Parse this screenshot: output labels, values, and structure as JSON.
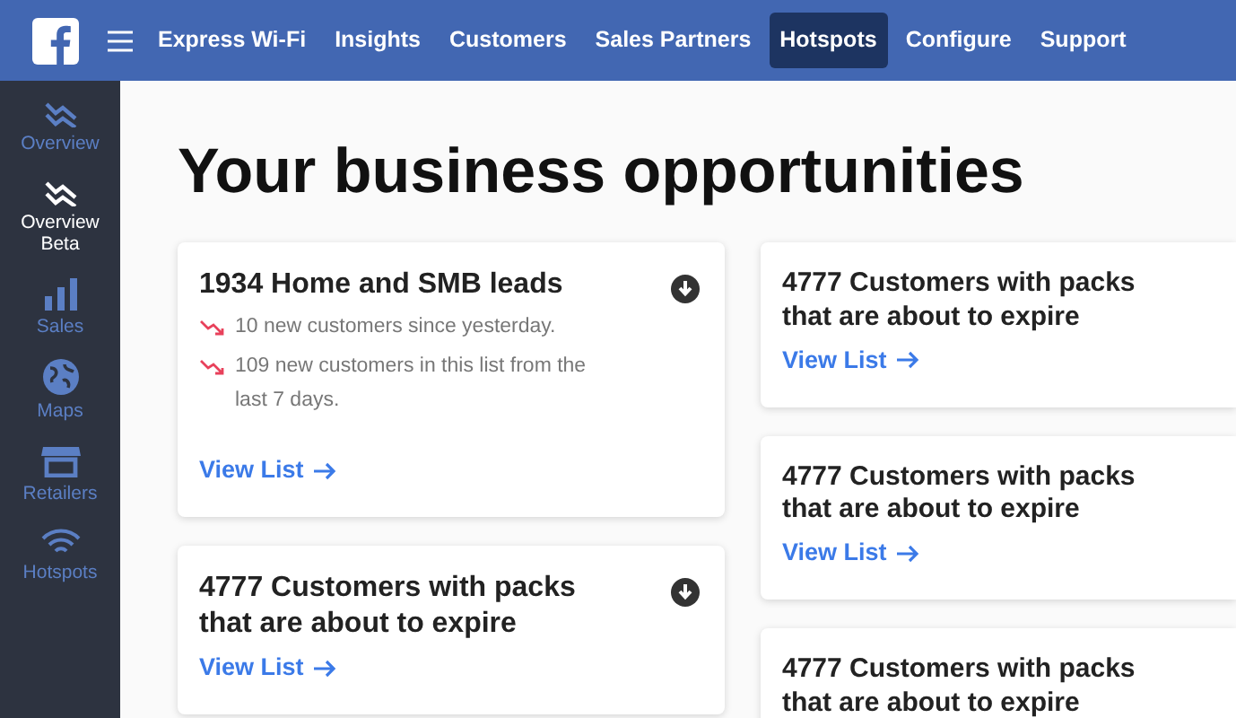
{
  "navbar": {
    "items": [
      {
        "label": "Express Wi-Fi",
        "selected": false
      },
      {
        "label": "Insights",
        "selected": false
      },
      {
        "label": "Customers",
        "selected": false
      },
      {
        "label": "Sales Partners",
        "selected": false
      },
      {
        "label": "Hotspots",
        "selected": true
      },
      {
        "label": "Configure",
        "selected": false
      },
      {
        "label": "Support",
        "selected": false
      }
    ]
  },
  "sidebar": {
    "items": [
      {
        "label": "Overview",
        "kind": "trend",
        "selected": false
      },
      {
        "label": "Overview Beta",
        "kind": "trend",
        "selected": true
      },
      {
        "label": "Sales",
        "kind": "bars",
        "selected": false
      },
      {
        "label": "Maps",
        "kind": "globe",
        "selected": false
      },
      {
        "label": "Retailers",
        "kind": "store",
        "selected": false
      },
      {
        "label": "Hotspots",
        "kind": "wifi",
        "selected": false
      }
    ]
  },
  "heading": "Your business opportunities",
  "columns": [
    {
      "cards": [
        {
          "title": "1934 Home and SMB leads",
          "download": true,
          "bullets": [
            "10 new customers since yesterday.",
            "109 new customers in this list from the last 7 days."
          ],
          "link": "View List"
        },
        {
          "title": "4777 Customers with packs that are about to expire",
          "download": true,
          "link": "View List"
        }
      ]
    },
    {
      "cards": [
        {
          "title": "4777 Customers with packs that are about to expire",
          "download": false,
          "link": "View List"
        },
        {
          "title": "4777 Customers with packs that are about to expire",
          "download": false,
          "link": "View List"
        },
        {
          "title": "4777 Customers with packs that are about to expire",
          "download": false
        }
      ]
    }
  ]
}
